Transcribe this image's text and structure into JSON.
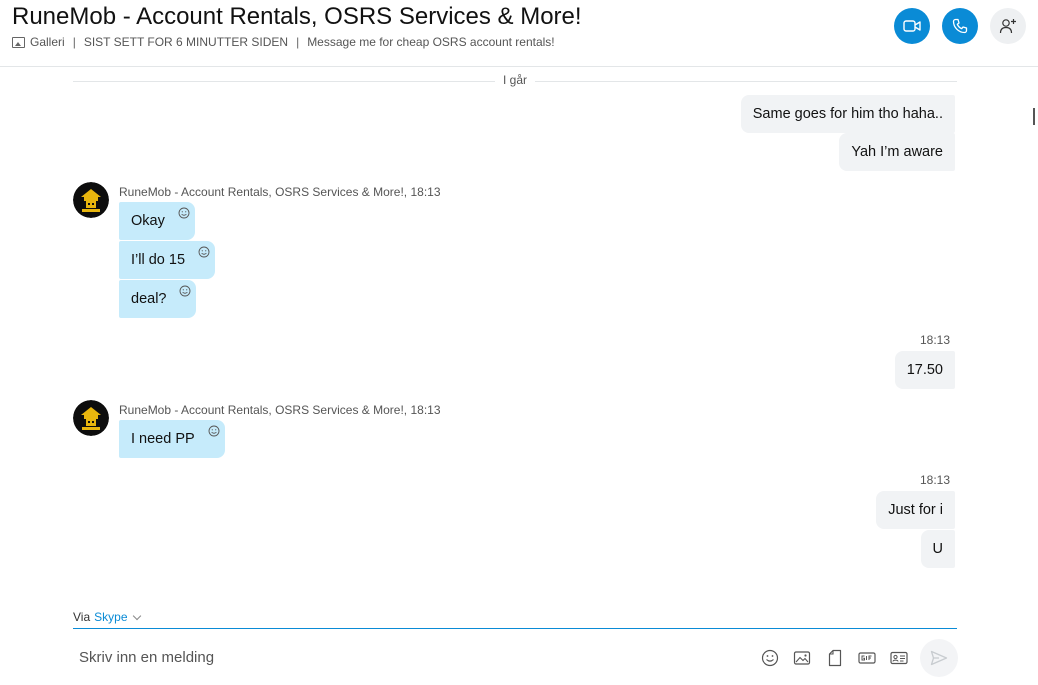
{
  "header": {
    "title": "RuneMob - Account Rentals, OSRS Services & More!",
    "gallery_label": "Galleri",
    "last_seen": "SIST SETT FOR 6 MINUTTER SIDEN",
    "mood": "Message me for cheap OSRS account rentals!",
    "buttons": {
      "video": "video-call-icon",
      "call": "phone-icon",
      "add": "add-person-icon"
    },
    "accent_color": "#0a8bd6"
  },
  "conversation": {
    "day_divider": "I går",
    "out_group_1": [
      "Same goes for him tho haha..",
      "Yah I’m aware"
    ],
    "in_group_1": {
      "sender": "RuneMob - Account Rentals, OSRS Services & More!,",
      "time": "18:13",
      "messages": [
        "Okay",
        "I’ll do 15",
        "deal?"
      ]
    },
    "out_group_2": {
      "time": "18:13",
      "messages": [
        "17.50"
      ]
    },
    "in_group_2": {
      "sender": "RuneMob - Account Rentals, OSRS Services & More!,",
      "time": "18:13",
      "messages": [
        "I need PP"
      ]
    },
    "out_group_3": {
      "time": "18:13",
      "messages": [
        "Just for i",
        "U"
      ]
    },
    "incoming_bubble_color": "#c6ebfb",
    "outgoing_bubble_color": "#f1f3f5"
  },
  "composer": {
    "via_label": "Via",
    "via_service": "Skype",
    "placeholder": "Skriv inn en melding",
    "icons": [
      "emoji-icon",
      "image-icon",
      "file-icon",
      "gif-icon",
      "contact-card-icon",
      "send-icon"
    ]
  }
}
